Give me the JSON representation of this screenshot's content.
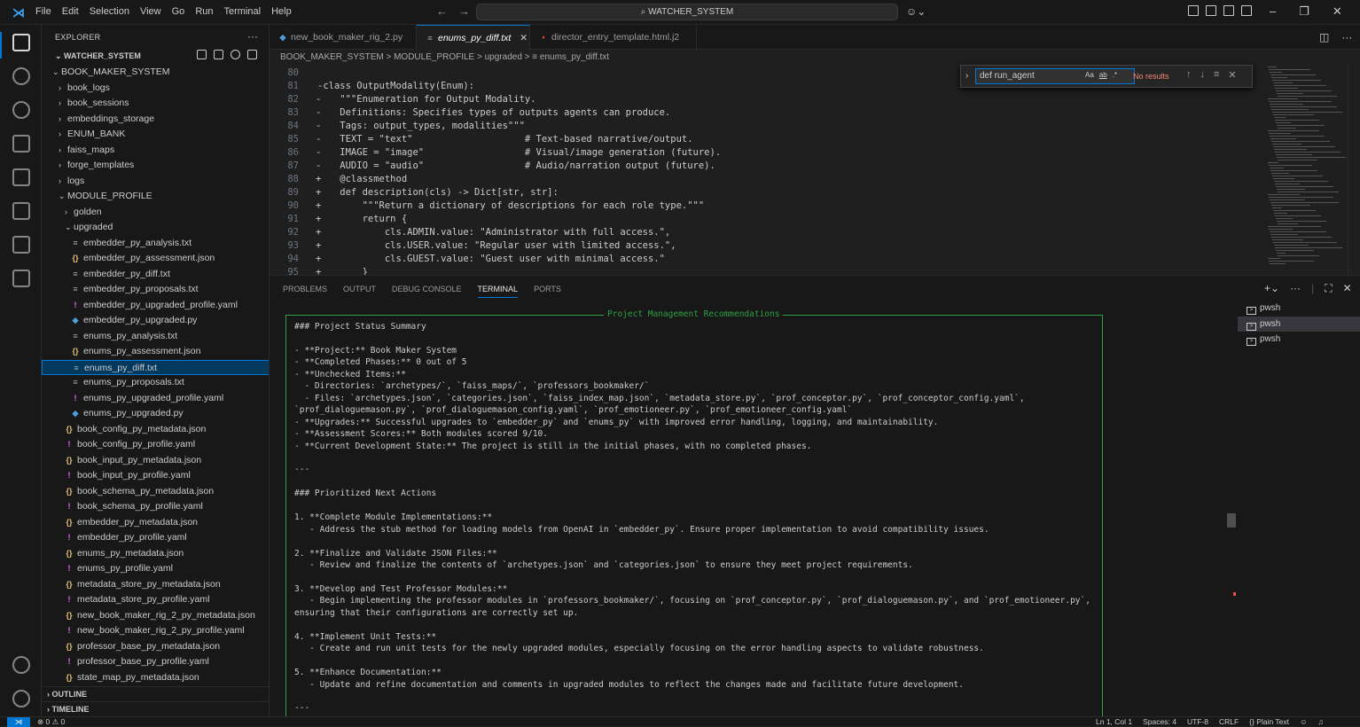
{
  "titlebar": {
    "menu": [
      "File",
      "Edit",
      "Selection",
      "View",
      "Go",
      "Run",
      "Terminal",
      "Help"
    ],
    "search": "WATCHER_SYSTEM"
  },
  "explorer": {
    "title": "EXPLORER",
    "workspace": "WATCHER_SYSTEM",
    "tree": [
      {
        "label": "BOOK_MAKER_SYSTEM",
        "type": "folder",
        "open": true,
        "indent": 0
      },
      {
        "label": "book_logs",
        "type": "folder",
        "open": false,
        "indent": 1
      },
      {
        "label": "book_sessions",
        "type": "folder",
        "open": false,
        "indent": 1
      },
      {
        "label": "embeddings_storage",
        "type": "folder",
        "open": false,
        "indent": 1
      },
      {
        "label": "ENUM_BANK",
        "type": "folder",
        "open": false,
        "indent": 1
      },
      {
        "label": "faiss_maps",
        "type": "folder",
        "open": false,
        "indent": 1
      },
      {
        "label": "forge_templates",
        "type": "folder",
        "open": false,
        "indent": 1
      },
      {
        "label": "logs",
        "type": "folder",
        "open": false,
        "indent": 1
      },
      {
        "label": "MODULE_PROFILE",
        "type": "folder",
        "open": true,
        "indent": 1
      },
      {
        "label": "golden",
        "type": "folder",
        "open": false,
        "indent": 2
      },
      {
        "label": "upgraded",
        "type": "folder",
        "open": true,
        "indent": 2
      },
      {
        "label": "embedder_py_analysis.txt",
        "type": "txt",
        "indent": 3
      },
      {
        "label": "embedder_py_assessment.json",
        "type": "json",
        "indent": 3
      },
      {
        "label": "embedder_py_diff.txt",
        "type": "txt",
        "indent": 3
      },
      {
        "label": "embedder_py_proposals.txt",
        "type": "txt",
        "indent": 3
      },
      {
        "label": "embedder_py_upgraded_profile.yaml",
        "type": "yaml",
        "indent": 3
      },
      {
        "label": "embedder_py_upgraded.py",
        "type": "py",
        "indent": 3
      },
      {
        "label": "enums_py_analysis.txt",
        "type": "txt",
        "indent": 3
      },
      {
        "label": "enums_py_assessment.json",
        "type": "json",
        "indent": 3
      },
      {
        "label": "enums_py_diff.txt",
        "type": "txt",
        "indent": 3,
        "selected": true
      },
      {
        "label": "enums_py_proposals.txt",
        "type": "txt",
        "indent": 3
      },
      {
        "label": "enums_py_upgraded_profile.yaml",
        "type": "yaml",
        "indent": 3
      },
      {
        "label": "enums_py_upgraded.py",
        "type": "py",
        "indent": 3
      },
      {
        "label": "book_config_py_metadata.json",
        "type": "json",
        "indent": 2
      },
      {
        "label": "book_config_py_profile.yaml",
        "type": "yaml",
        "indent": 2
      },
      {
        "label": "book_input_py_metadata.json",
        "type": "json",
        "indent": 2
      },
      {
        "label": "book_input_py_profile.yaml",
        "type": "yaml",
        "indent": 2
      },
      {
        "label": "book_schema_py_metadata.json",
        "type": "json",
        "indent": 2
      },
      {
        "label": "book_schema_py_profile.yaml",
        "type": "yaml",
        "indent": 2
      },
      {
        "label": "embedder_py_metadata.json",
        "type": "json",
        "indent": 2
      },
      {
        "label": "embedder_py_profile.yaml",
        "type": "yaml",
        "indent": 2
      },
      {
        "label": "enums_py_metadata.json",
        "type": "json",
        "indent": 2
      },
      {
        "label": "enums_py_profile.yaml",
        "type": "yaml",
        "indent": 2
      },
      {
        "label": "metadata_store_py_metadata.json",
        "type": "json",
        "indent": 2
      },
      {
        "label": "metadata_store_py_profile.yaml",
        "type": "yaml",
        "indent": 2
      },
      {
        "label": "new_book_maker_rig_2_py_metadata.json",
        "type": "json",
        "indent": 2
      },
      {
        "label": "new_book_maker_rig_2_py_profile.yaml",
        "type": "yaml",
        "indent": 2
      },
      {
        "label": "professor_base_py_metadata.json",
        "type": "json",
        "indent": 2
      },
      {
        "label": "professor_base_py_profile.yaml",
        "type": "yaml",
        "indent": 2
      },
      {
        "label": "state_map_py_metadata.json",
        "type": "json",
        "indent": 2
      }
    ],
    "outline": "OUTLINE",
    "timeline": "TIMELINE"
  },
  "tabs": [
    {
      "label": "new_book_maker_rig_2.py",
      "icon": "py",
      "active": false
    },
    {
      "label": "enums_py_diff.txt",
      "icon": "txt",
      "active": true
    },
    {
      "label": "director_entry_template.html.j2",
      "icon": "html",
      "active": false
    }
  ],
  "breadcrumb": "BOOK_MAKER_SYSTEM > MODULE_PROFILE > upgraded > ≡ enums_py_diff.txt",
  "find": {
    "query": "def run_agent",
    "result": "No results",
    "opts": [
      "Aa",
      "ab",
      ".*"
    ]
  },
  "code": [
    {
      "n": "80",
      "m": "",
      "t": ""
    },
    {
      "n": "81",
      "m": "",
      "t": "-class OutputModality(Enum):"
    },
    {
      "n": "82",
      "m": "-",
      "t": "    \"\"\"Enumeration for Output Modality."
    },
    {
      "n": "83",
      "m": "-",
      "t": "    Definitions: Specifies types of outputs agents can produce."
    },
    {
      "n": "84",
      "m": "-",
      "t": "    Tags: output_types, modalities\"\"\""
    },
    {
      "n": "85",
      "m": "-",
      "t": "    TEXT = \"text\"                    # Text-based narrative/output."
    },
    {
      "n": "86",
      "m": "-",
      "t": "    IMAGE = \"image\"                  # Visual/image generation (future)."
    },
    {
      "n": "87",
      "m": "-",
      "t": "    AUDIO = \"audio\"                  # Audio/narration output (future)."
    },
    {
      "n": "88",
      "m": "+",
      "t": "    @classmethod"
    },
    {
      "n": "89",
      "m": "+",
      "t": "    def description(cls) -> Dict[str, str]:"
    },
    {
      "n": "90",
      "m": "+",
      "t": "        \"\"\"Return a dictionary of descriptions for each role type.\"\"\""
    },
    {
      "n": "91",
      "m": "+",
      "t": "        return {"
    },
    {
      "n": "92",
      "m": "+",
      "t": "            cls.ADMIN.value: \"Administrator with full access.\","
    },
    {
      "n": "93",
      "m": "+",
      "t": "            cls.USER.value: \"Regular user with limited access.\","
    },
    {
      "n": "94",
      "m": "+",
      "t": "            cls.GUEST.value: \"Guest user with minimal access.\""
    },
    {
      "n": "95",
      "m": "+",
      "t": "        }"
    }
  ],
  "panel": {
    "tabs": [
      "PROBLEMS",
      "OUTPUT",
      "DEBUG CONSOLE",
      "TERMINAL",
      "PORTS"
    ],
    "active_tab": "TERMINAL",
    "box_title": "Project Management Recommendations",
    "lines": [
      "### Project Status Summary",
      "",
      "- **Project:** Book Maker System",
      "- **Completed Phases:** 0 out of 5",
      "- **Unchecked Items:**",
      "  - Directories: `archetypes/`, `faiss_maps/`, `professors_bookmaker/`",
      "  - Files: `archetypes.json`, `categories.json`, `faiss_index_map.json`, `metadata_store.py`, `prof_conceptor.py`, `prof_conceptor_config.yaml`,",
      "`prof_dialoguemason.py`, `prof_dialoguemason_config.yaml`, `prof_emotioneer.py`, `prof_emotioneer_config.yaml`",
      "- **Upgrades:** Successful upgrades to `embedder_py` and `enums_py` with improved error handling, logging, and maintainability.",
      "- **Assessment Scores:** Both modules scored 9/10.",
      "- **Current Development State:** The project is still in the initial phases, with no completed phases.",
      "",
      "---",
      "",
      "### Prioritized Next Actions",
      "",
      "1. **Complete Module Implementations:**",
      "   - Address the stub method for loading models from OpenAI in `embedder_py`. Ensure proper implementation to avoid compatibility issues.",
      "",
      "2. **Finalize and Validate JSON Files:**",
      "   - Review and finalize the contents of `archetypes.json` and `categories.json` to ensure they meet project requirements.",
      "",
      "3. **Develop and Test Professor Modules:**",
      "   - Begin implementing the professor modules in `professors_bookmaker/`, focusing on `prof_conceptor.py`, `prof_dialoguemason.py`, and `prof_emotioneer.py`,",
      "ensuring that their configurations are correctly set up.",
      "",
      "4. **Implement Unit Tests:**",
      "   - Create and run unit tests for the newly upgraded modules, especially focusing on the error handling aspects to validate robustness.",
      "",
      "5. **Enhance Documentation:**",
      "   - Update and refine documentation and comments in upgraded modules to reflect the changes made and facilitate future development.",
      "",
      "---"
    ],
    "terminals": [
      "pwsh",
      "pwsh",
      "pwsh"
    ]
  },
  "status": {
    "errors": "⊗ 0 ⚠ 0",
    "right": [
      "Ln 1, Col 1",
      "Spaces: 4",
      "UTF-8",
      "CRLF",
      "{} Plain Text"
    ]
  },
  "colors": {
    "accent": "#0078d4",
    "box_border": "#2ea043"
  }
}
